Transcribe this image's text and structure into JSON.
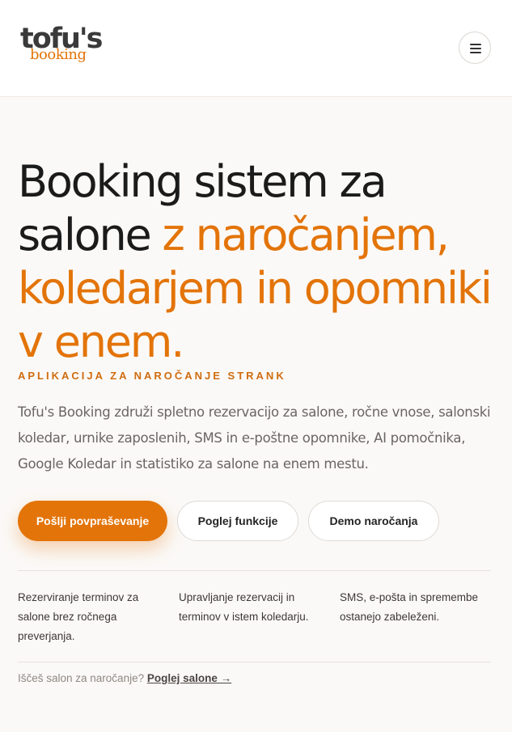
{
  "header": {
    "logo_main": "tofu's",
    "logo_sub": "booking",
    "menu_icon": "hamburger-menu-icon"
  },
  "hero": {
    "title_plain": "Booking sistem za salone ",
    "title_accent": "z naročanjem, koledarjem in opomniki v enem.",
    "eyebrow": "APLIKACIJA ZA NAROČANJE STRANK",
    "lead": "Tofu's Booking združi spletno rezervacijo za salone, ročne vnose, salonski koledar, urnike zaposlenih, SMS in e-poštne opomnike, AI pomočnika, Google Koledar in statistiko za salone na enem mestu."
  },
  "buttons": {
    "primary": "Pošlji povpraševanje",
    "features": "Poglej funkcije",
    "demo": "Demo naročanja"
  },
  "features": [
    {
      "text": "Rezerviranje terminov za salone brez ročnega preverjanja."
    },
    {
      "text": "Upravljanje rezervacij in terminov v istem koledarju."
    },
    {
      "text": "SMS, e-pošta in spremembe ostanejo zabeleženi."
    }
  ],
  "footer": {
    "note": "Iščeš salon za naročanje?",
    "link": "Poglej salone →"
  },
  "colors": {
    "accent": "#e37409",
    "text": "#1b1b1b",
    "background": "#fbf9f7"
  }
}
